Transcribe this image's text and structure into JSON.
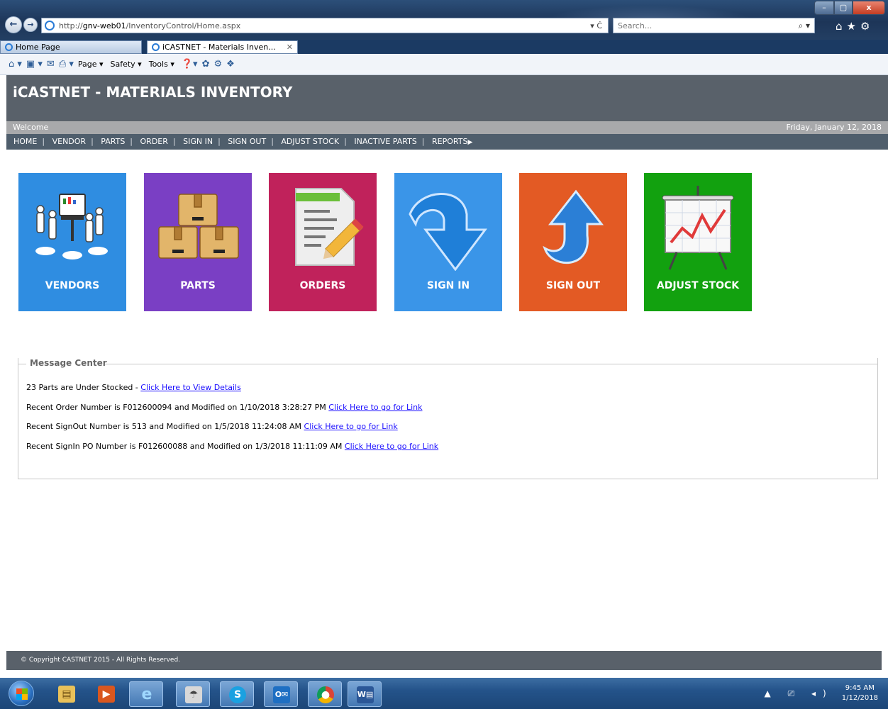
{
  "browser": {
    "url_prefix": "http://",
    "url_host": "gnv-web01",
    "url_path": "/InventoryControl/Home.aspx",
    "address_controls": "▾ Ċ",
    "search_placeholder": "Search...",
    "tabs": [
      {
        "label": "Home Page"
      },
      {
        "label": "iCASTNET - Materials Inven...",
        "active": true
      }
    ],
    "commands": [
      "Page ▾",
      "Safety ▾",
      "Tools ▾"
    ],
    "window_buttons": {
      "minimize": "–",
      "maximize": "▢",
      "close": "x"
    }
  },
  "app": {
    "title": "iCASTNET - MATERIALS INVENTORY",
    "welcome": "Welcome",
    "date": "Friday, January 12, 2018",
    "menu": [
      "HOME",
      "VENDOR",
      "PARTS",
      "ORDER",
      "SIGN IN",
      "SIGN OUT",
      "ADJUST STOCK",
      "INACTIVE PARTS",
      "REPORTS"
    ]
  },
  "tiles": [
    {
      "label": "VENDORS",
      "color": "#2f8de1",
      "icon": "people-monitor-icon"
    },
    {
      "label": "PARTS",
      "color": "#7a3fc4",
      "icon": "boxes-icon"
    },
    {
      "label": "ORDERS",
      "color": "#c0225b",
      "icon": "document-pencil-icon"
    },
    {
      "label": "SIGN IN",
      "color": "#3a95e8",
      "icon": "arrow-down-icon"
    },
    {
      "label": "SIGN OUT",
      "color": "#e35a24",
      "icon": "arrow-up-icon"
    },
    {
      "label": "ADJUST STOCK",
      "color": "#12a10f",
      "icon": "chart-easel-icon"
    }
  ],
  "message_center": {
    "legend": "Message Center",
    "messages": [
      {
        "text": "23 Parts are Under Stocked - ",
        "link": "Click Here to View Details"
      },
      {
        "text": "Recent Order Number is F012600094 and Modified on 1/10/2018 3:28:27 PM ",
        "link": "Click Here to go for Link"
      },
      {
        "text": "Recent SignOut Number is 513 and Modified on 1/5/2018 11:24:08 AM ",
        "link": "Click Here to go for Link"
      },
      {
        "text": "Recent SignIn PO Number is F012600088 and Modified on 1/3/2018 11:11:09 AM ",
        "link": "Click Here to go for Link"
      }
    ]
  },
  "footer": "© Copyright CASTNET 2015 - All Rights Reserved.",
  "taskbar": {
    "time": "9:45 AM",
    "date": "1/12/2018"
  }
}
